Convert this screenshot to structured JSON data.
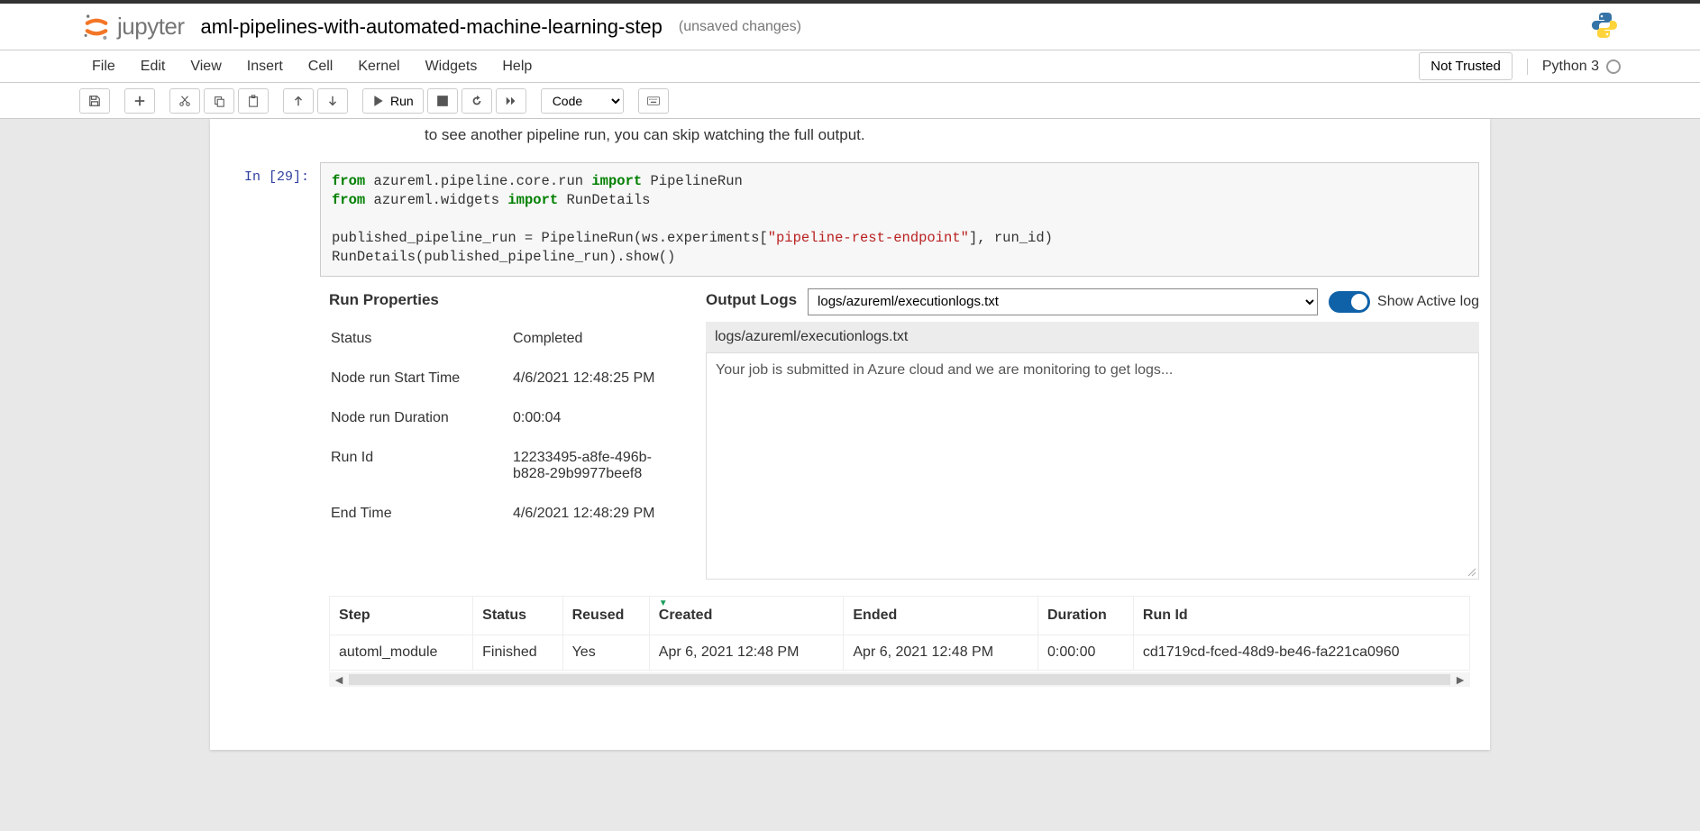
{
  "header": {
    "logo_text": "jupyter",
    "notebook_title": "aml-pipelines-with-automated-machine-learning-step",
    "unsaved_label": "(unsaved changes)",
    "trust_label": "Not Trusted",
    "kernel_label": "Python 3"
  },
  "menu": {
    "items": [
      "File",
      "Edit",
      "View",
      "Insert",
      "Cell",
      "Kernel",
      "Widgets",
      "Help"
    ]
  },
  "toolbar": {
    "run_label": "Run",
    "cell_type": "Code"
  },
  "above_text": "to see another pipeline run, you can skip watching the full output.",
  "cell": {
    "prompt": "In [29]:",
    "code": {
      "line1_kw1": "from",
      "line1_mod": " azureml.pipeline.core.run ",
      "line1_kw2": "import",
      "line1_rest": " PipelineRun",
      "line2_kw1": "from",
      "line2_mod": " azureml.widgets ",
      "line2_kw2": "import",
      "line2_rest": " RunDetails",
      "blank": "",
      "line3_pre": "published_pipeline_run = PipelineRun(ws.experiments[",
      "line3_str": "\"pipeline-rest-endpoint\"",
      "line3_post": "], run_id)",
      "line4": "RunDetails(published_pipeline_run).show()"
    }
  },
  "widget": {
    "run_props_title": "Run Properties",
    "props": [
      {
        "label": "Status",
        "value": "Completed"
      },
      {
        "label": "Node run Start Time",
        "value": "4/6/2021 12:48:25 PM"
      },
      {
        "label": "Node run Duration",
        "value": "0:00:04"
      },
      {
        "label": "Run Id",
        "value": "12233495-a8fe-496b-b828-29b9977beef8"
      },
      {
        "label": "End Time",
        "value": "4/6/2021 12:48:29 PM"
      }
    ],
    "logs_title": "Output Logs",
    "logs_select_value": "logs/azureml/executionlogs.txt",
    "toggle_label": "Show Active log",
    "log_path": "logs/azureml/executionlogs.txt",
    "log_message": "Your job is submitted in Azure cloud and we are monitoring to get logs...",
    "steps": {
      "headers": [
        "Step",
        "Status",
        "Reused",
        "Created",
        "Ended",
        "Duration",
        "Run Id"
      ],
      "row": {
        "step": "automl_module",
        "status": "Finished",
        "reused": "Yes",
        "created": "Apr 6, 2021 12:48 PM",
        "ended": "Apr 6, 2021 12:48 PM",
        "duration": "0:00:00",
        "runid": "cd1719cd-fced-48d9-be46-fa221ca0960"
      }
    }
  }
}
